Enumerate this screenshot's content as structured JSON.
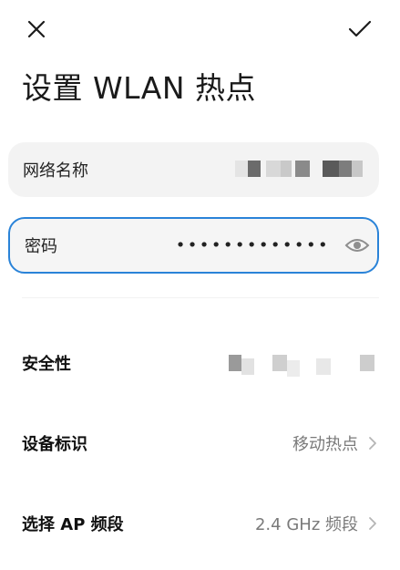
{
  "header": {
    "close_icon": "close-icon",
    "confirm_icon": "check-icon",
    "title": "设置 WLAN 热点"
  },
  "form": {
    "ssid": {
      "label": "网络名称"
    },
    "password": {
      "label": "密码",
      "masked_value": "•••••••••••••",
      "toggle_icon": "eye-icon"
    }
  },
  "settings": {
    "security": {
      "label": "安全性"
    },
    "device_id": {
      "label": "设备标识",
      "value": "移动热点"
    },
    "ap_band": {
      "label": "选择 AP 频段",
      "value": "2.4 GHz 频段"
    }
  },
  "colors": {
    "accent": "#2a83d8",
    "field_bg": "#f3f3f3",
    "secondary_text": "#7a7a7a"
  }
}
